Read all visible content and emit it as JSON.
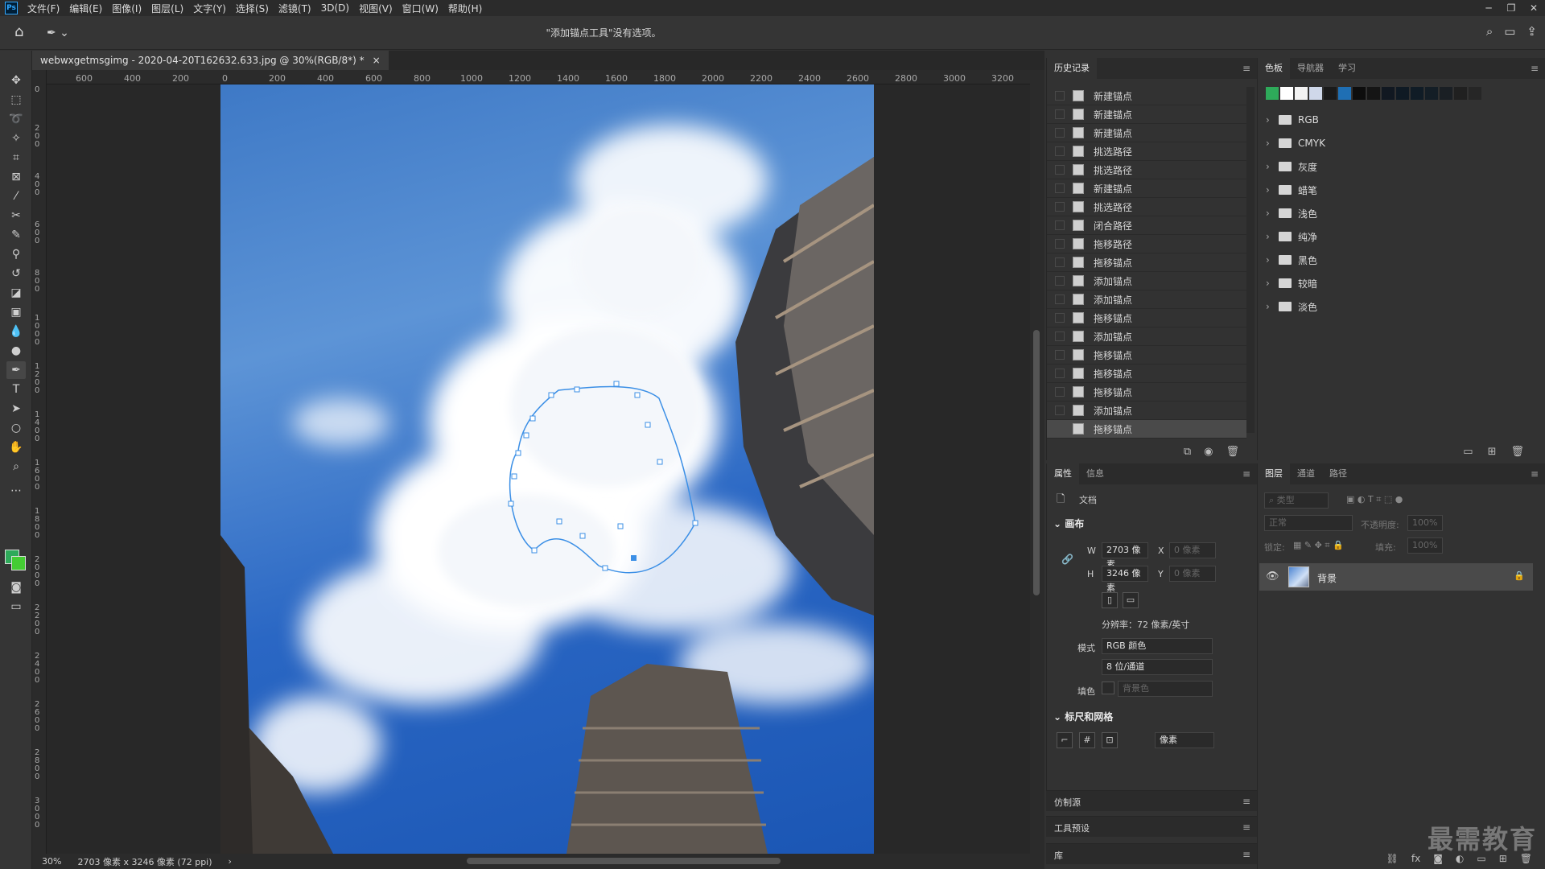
{
  "app": {
    "logo": "Ps"
  },
  "menu": [
    "文件(F)",
    "编辑(E)",
    "图像(I)",
    "图层(L)",
    "文字(Y)",
    "选择(S)",
    "滤镜(T)",
    "3D(D)",
    "视图(V)",
    "窗口(W)",
    "帮助(H)"
  ],
  "window_controls": [
    "─",
    "❐",
    "✕"
  ],
  "options_bar": {
    "message": "\"添加锚点工具\"没有选项。",
    "home_icon": "home-icon",
    "pen_icon": "pen-tool-icon"
  },
  "document": {
    "tab_title": "webwxgetmsgimg - 2020-04-20T162632.633.jpg @ 30%(RGB/8*) *",
    "close": "×",
    "ruler_h_labels": [
      "600",
      "400",
      "200",
      "0",
      "200",
      "400",
      "600",
      "800",
      "1000",
      "1200",
      "1400",
      "1600",
      "1800",
      "2000",
      "2200",
      "2400",
      "2600",
      "2800",
      "3000",
      "3200"
    ],
    "ruler_v_labels": [
      "0",
      "200",
      "400",
      "600",
      "800",
      "1000",
      "1200",
      "1400",
      "1600",
      "1800",
      "2000",
      "2200",
      "2400",
      "2600",
      "2800",
      "3000"
    ],
    "zoom": "30%",
    "size_info": "2703 像素 x 3246 像素 (72 ppi)",
    "status_arrow": "›"
  },
  "history": {
    "tabs": [
      "历史记录"
    ],
    "items": [
      "新建锚点",
      "新建锚点",
      "新建锚点",
      "挑选路径",
      "挑选路径",
      "新建锚点",
      "挑选路径",
      "闭合路径",
      "拖移路径",
      "拖移锚点",
      "添加锚点",
      "添加锚点",
      "拖移锚点",
      "添加锚点",
      "拖移锚点",
      "拖移锚点",
      "拖移锚点",
      "添加锚点",
      "拖移锚点"
    ],
    "selected_index": 18
  },
  "swatches": {
    "tabs": [
      "色板",
      "导航器",
      "学习"
    ],
    "recent_colors": [
      "#2eaa5a",
      "#ffffff",
      "#f2f2f2",
      "#cfd8ea",
      "#1a1a1a",
      "#1f6fb4",
      "#0d0d0d",
      "#151515",
      "#111821",
      "#0f1a24",
      "#101c26",
      "#141e26",
      "#1a1f24",
      "#202020",
      "#262626"
    ],
    "groups": [
      "RGB",
      "CMYK",
      "灰度",
      "蜡笔",
      "浅色",
      "纯净",
      "黑色",
      "较暗",
      "淡色"
    ]
  },
  "properties": {
    "tabs": [
      "属性",
      "信息"
    ],
    "doc_label": "文档",
    "canvas_section": "画布",
    "w_label": "W",
    "w_value": "2703 像素",
    "h_label": "H",
    "h_value": "3246 像素",
    "x_label": "X",
    "x_value": "0 像素",
    "y_label": "Y",
    "y_value": "0 像素",
    "resolution": "分辨率：72 像素/英寸",
    "mode_label": "模式",
    "mode_value": "RGB 颜色",
    "depth_value": "8 位/通道",
    "fill_label": "填色",
    "fill_value": "背景色",
    "rulers_section": "标尺和网格",
    "unit_value": "像素"
  },
  "collapsed_panels": [
    "仿制源",
    "工具预设",
    "库"
  ],
  "layers": {
    "tabs": [
      "图层",
      "通道",
      "路径"
    ],
    "filter_placeholder": "类型",
    "blend_mode": "正常",
    "opacity_label": "不透明度:",
    "opacity_value": "100%",
    "lock_label": "锁定:",
    "fill_label": "填充:",
    "fill_value": "100%",
    "layer_name": "背景"
  },
  "watermark": "最需教育"
}
